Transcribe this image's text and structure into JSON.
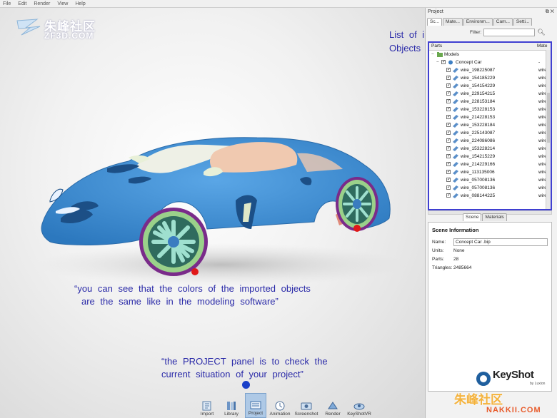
{
  "menubar": {
    "items": [
      "File",
      "Edit",
      "Render",
      "View",
      "Help"
    ]
  },
  "watermark": {
    "line1": "朱峰社区",
    "line2": "ZF3D.COM",
    "line3": "NAKKII.COM"
  },
  "viewport": {
    "caption_objects": "List of imported\nObjects",
    "caption_colors_1": "“you can see that the colors of the imported objects",
    "caption_colors_2": "are the same like in the modeling software”",
    "caption_project_1": "“the PROJECT panel is to check the",
    "caption_project_2": "current situation of your project”",
    "car_body_color": "#3d8fd6"
  },
  "dock": {
    "items": [
      {
        "label": "Import",
        "icon": "import-icon"
      },
      {
        "label": "Library",
        "icon": "library-icon"
      },
      {
        "label": "Project",
        "icon": "project-icon",
        "active": true
      },
      {
        "label": "Animation",
        "icon": "animation-icon"
      },
      {
        "label": "Screenshot",
        "icon": "screenshot-icon"
      },
      {
        "label": "Render",
        "icon": "render-icon"
      },
      {
        "label": "KeyShotVR",
        "icon": "keyshotvr-icon"
      }
    ]
  },
  "panel": {
    "title": "Project",
    "tabs": [
      "Sc...",
      "Mate...",
      "Environm...",
      "Cam...",
      "Setti..."
    ],
    "filter_label": "Filter:",
    "filter_value": "",
    "tree_headers": {
      "parts": "Parts",
      "material": "Mate"
    },
    "tree_root": "Models",
    "tree_model": "Concept Car",
    "tree_model_material": "-",
    "parts": [
      {
        "name": "wire_198225087",
        "material": "wire"
      },
      {
        "name": "wire_154185229",
        "material": "wire"
      },
      {
        "name": "wire_154154229",
        "material": "wire"
      },
      {
        "name": "wire_229154215",
        "material": "wire"
      },
      {
        "name": "wire_228153184",
        "material": "wire"
      },
      {
        "name": "wire_153228153",
        "material": "wire"
      },
      {
        "name": "wire_214228153",
        "material": "wire"
      },
      {
        "name": "wire_153228184",
        "material": "wire"
      },
      {
        "name": "wire_225143087",
        "material": "wire"
      },
      {
        "name": "wire_224086086",
        "material": "wire"
      },
      {
        "name": "wire_153228214",
        "material": "wire"
      },
      {
        "name": "wire_154215229",
        "material": "wire"
      },
      {
        "name": "wire_214229166",
        "material": "wire"
      },
      {
        "name": "wire_113135006",
        "material": "wire"
      },
      {
        "name": "wire_057008136",
        "material": "wire"
      },
      {
        "name": "wire_057008136",
        "material": "wire"
      },
      {
        "name": "wire_088144225",
        "material": "wire"
      }
    ],
    "lower_tabs": [
      "Scene",
      "Materials"
    ],
    "scene_info": {
      "heading": "Scene Information",
      "name_label": "Name:",
      "name_value": "Concept Car .bip",
      "units_label": "Units:",
      "units_value": "None",
      "parts_label": "Parts:",
      "parts_value": "28",
      "triangles_label": "Triangles:",
      "triangles_value": "2485664"
    },
    "logo_text": "KeyShot",
    "logo_sub": "by Luxion"
  }
}
